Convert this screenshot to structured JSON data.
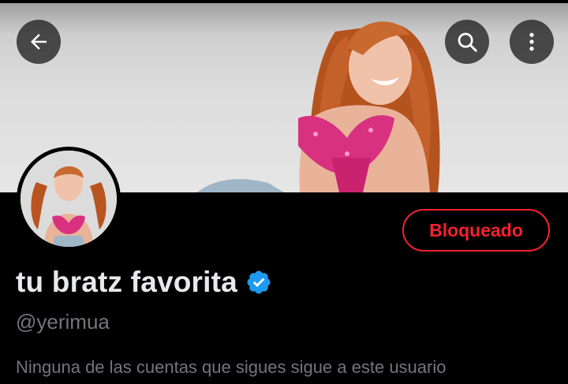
{
  "header": {
    "back_icon": "arrow-left-icon",
    "search_icon": "search-icon",
    "more_icon": "more-vertical-icon"
  },
  "profile": {
    "display_name": "tu bratz favorita",
    "verified": true,
    "handle": "@yerimua",
    "block_button_label": "Bloqueado",
    "followers_note": "Ninguna de las cuentas que sigues sigue a este usuario"
  },
  "colors": {
    "background": "#000000",
    "blocked_red": "#f4212e",
    "verified_blue": "#1d9bf0",
    "primary_text": "#e7e9ea",
    "secondary_text": "#71767b"
  }
}
